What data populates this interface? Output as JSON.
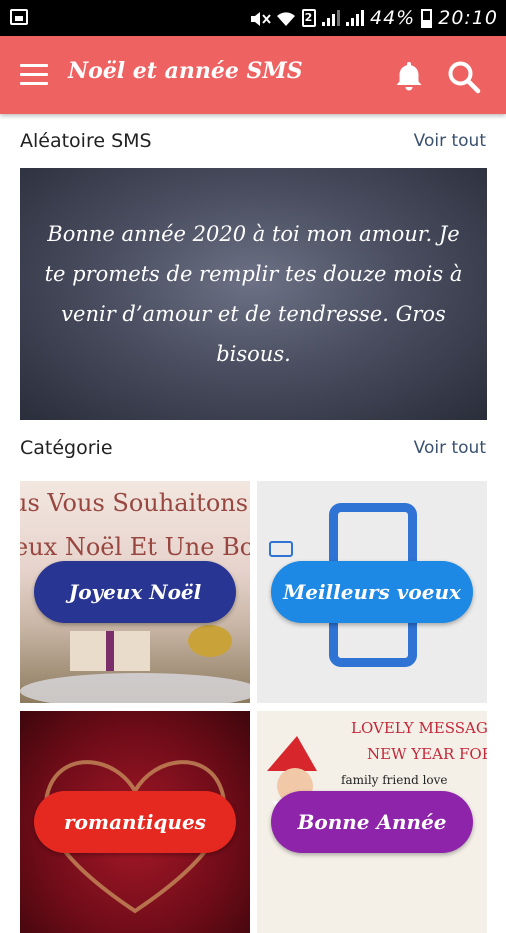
{
  "status_bar": {
    "battery_percent": "44%",
    "time": "20:10",
    "sim_label": "2"
  },
  "app_bar": {
    "title": "Noël et année SMS",
    "icons": [
      "menu-icon",
      "bell-icon",
      "search-icon"
    ]
  },
  "random_section": {
    "label": "Aléatoire SMS",
    "see_all": "Voir tout",
    "card_text": "Bonne année 2020 à toi mon amour. Je te promets de remplir tes douze mois à venir d’amour et de tendresse. Gros bisous."
  },
  "category_section": {
    "label": "Catégorie",
    "see_all": "Voir tout",
    "tiles": [
      {
        "label": "Joyeux Noël",
        "pill_color": "#283593",
        "image_text_1": "us Vous Souhaitons",
        "image_text_2": "eux Noël Et Une Bo"
      },
      {
        "label": "Meilleurs voeux",
        "pill_color": "#1e88e5"
      },
      {
        "label": "romantiques",
        "pill_color": "#e52920"
      },
      {
        "label": "Bonne Année",
        "pill_color": "#8e24aa",
        "image_text_1": "LOVELY MESSAGE",
        "image_text_2": "NEW YEAR FOR :",
        "image_text_3": "family friend love"
      }
    ]
  },
  "colors": {
    "app_bar": "#ee6262",
    "see_all": "#3a5170"
  }
}
